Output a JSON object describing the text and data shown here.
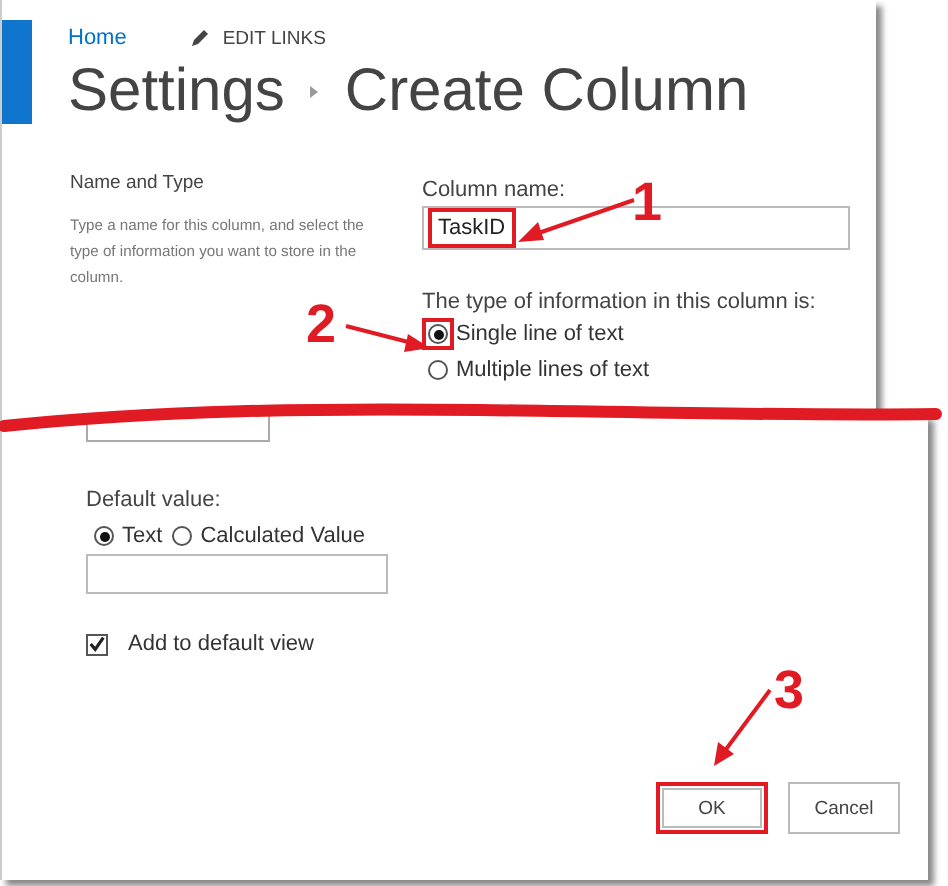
{
  "breadcrumb": {
    "home": "Home",
    "edit_links": "EDIT LINKS"
  },
  "title": {
    "parent": "Settings",
    "current": "Create Column"
  },
  "section": {
    "heading": "Name and Type",
    "description": "Type a name for this column, and select the type of information you want to store in the column."
  },
  "column_name": {
    "label": "Column name:",
    "value": "TaskID",
    "highlighted": true
  },
  "type": {
    "label": "The type of information in this column is:",
    "options": [
      {
        "label": "Single line of text",
        "selected": true,
        "highlighted": true
      },
      {
        "label": "Multiple lines of text",
        "selected": false,
        "highlighted": false
      }
    ]
  },
  "default_value": {
    "label": "Default value:",
    "options": [
      {
        "label": "Text",
        "selected": true
      },
      {
        "label": "Calculated Value",
        "selected": false
      }
    ]
  },
  "add_to_default_view": {
    "label": "Add to default view",
    "checked": true
  },
  "buttons": [
    {
      "label": "OK",
      "highlighted": true
    },
    {
      "label": "Cancel",
      "highlighted": false
    }
  ],
  "annotations": [
    "1",
    "2",
    "3"
  ]
}
